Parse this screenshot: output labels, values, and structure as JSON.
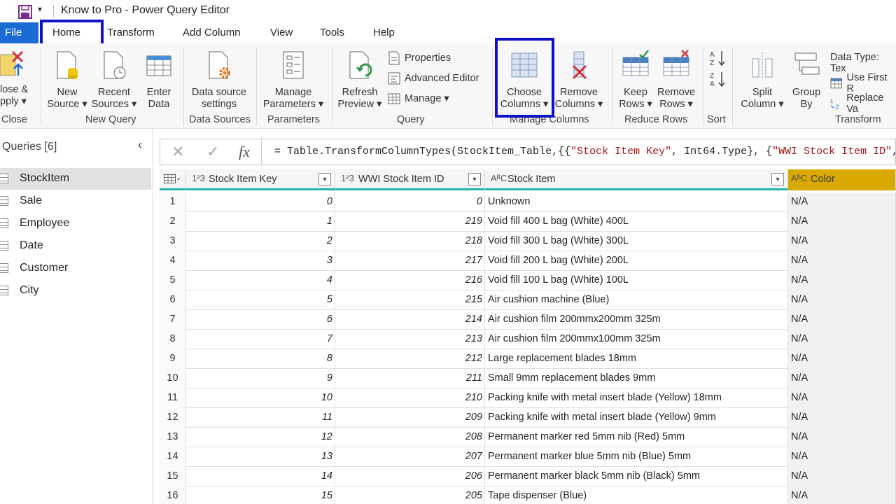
{
  "app": {
    "title": "Know to Pro - Power Query Editor",
    "qat_arrow": "▾"
  },
  "menu": {
    "file": "File",
    "tabs": [
      "Home",
      "Transform",
      "Add Column",
      "View",
      "Tools",
      "Help"
    ]
  },
  "ribbon": {
    "close_apply": [
      "lose &",
      "pply ▾"
    ],
    "close_group": "Close",
    "new_source": [
      "New",
      "Source ▾"
    ],
    "recent_sources": [
      "Recent",
      "Sources ▾"
    ],
    "enter_data": [
      "Enter",
      "Data"
    ],
    "new_query_group": "New Query",
    "data_source_settings": [
      "Data source",
      "settings"
    ],
    "data_sources_group": "Data Sources",
    "manage_parameters": [
      "Manage",
      "Parameters ▾"
    ],
    "parameters_group": "Parameters",
    "refresh_preview": [
      "Refresh",
      "Preview ▾"
    ],
    "properties": "Properties",
    "advanced_editor": "Advanced Editor",
    "manage": "Manage ▾",
    "query_group": "Query",
    "choose_columns": [
      "Choose",
      "Columns ▾"
    ],
    "remove_columns": [
      "Remove",
      "Columns ▾"
    ],
    "manage_columns_group": "Manage Columns",
    "keep_rows": [
      "Keep",
      "Rows ▾"
    ],
    "remove_rows": [
      "Remove",
      "Rows ▾"
    ],
    "reduce_rows_group": "Reduce Rows",
    "sort_group": "Sort",
    "split_column": [
      "Split",
      "Column ▾"
    ],
    "group_by": [
      "Group",
      "By"
    ],
    "data_type": "Data Type: Tex",
    "use_first_row": "Use First R",
    "replace_values": "Replace Va",
    "transform_group": "Transform"
  },
  "queries": {
    "header": "Queries [6]",
    "items": [
      "StockItem",
      "Sale",
      "Employee",
      "Date",
      "Customer",
      "City"
    ],
    "selected": "StockItem"
  },
  "formula": {
    "cancel": "✕",
    "commit": "✓",
    "fx": "fx",
    "prefix": "= Table.TransformColumnTypes(StockItem_Table,{{",
    "str1": "\"Stock Item Key\"",
    "mid": ", Int64.Type}, {",
    "str2": "\"WWI Stock Item ID\"",
    "suffix": ", I"
  },
  "columns": [
    {
      "type_icon": "1²3",
      "name": "Stock Item Key"
    },
    {
      "type_icon": "1²3",
      "name": "WWI Stock Item ID"
    },
    {
      "type_icon": "AᴮC",
      "name": "Stock Item"
    },
    {
      "type_icon": "AᴮC",
      "name": "Color"
    }
  ],
  "rows": [
    [
      "1",
      "0",
      "0",
      "Unknown",
      "N/A"
    ],
    [
      "2",
      "1",
      "219",
      "Void fill 400 L bag (White) 400L",
      "N/A"
    ],
    [
      "3",
      "2",
      "218",
      "Void fill 300 L bag (White) 300L",
      "N/A"
    ],
    [
      "4",
      "3",
      "217",
      "Void fill 200 L bag (White) 200L",
      "N/A"
    ],
    [
      "5",
      "4",
      "216",
      "Void fill 100 L bag (White) 100L",
      "N/A"
    ],
    [
      "6",
      "5",
      "215",
      "Air cushion machine (Blue)",
      "N/A"
    ],
    [
      "7",
      "6",
      "214",
      "Air cushion film 200mmx200mm 325m",
      "N/A"
    ],
    [
      "8",
      "7",
      "213",
      "Air cushion film 200mmx100mm 325m",
      "N/A"
    ],
    [
      "9",
      "8",
      "212",
      "Large  replacement blades 18mm",
      "N/A"
    ],
    [
      "10",
      "9",
      "211",
      "Small 9mm replacement blades 9mm",
      "N/A"
    ],
    [
      "11",
      "10",
      "210",
      "Packing knife with metal insert blade (Yellow) 18mm",
      "N/A"
    ],
    [
      "12",
      "11",
      "209",
      "Packing knife with metal insert blade (Yellow) 9mm",
      "N/A"
    ],
    [
      "13",
      "12",
      "208",
      "Permanent marker red 5mm nib (Red) 5mm",
      "N/A"
    ],
    [
      "14",
      "13",
      "207",
      "Permanent marker blue 5mm nib (Blue) 5mm",
      "N/A"
    ],
    [
      "15",
      "14",
      "206",
      "Permanent marker black 5mm nib (Black) 5mm",
      "N/A"
    ],
    [
      "16",
      "15",
      "205",
      "Tape dispenser (Blue)",
      "N/A"
    ]
  ],
  "colors": {
    "file_tab": "#1a6bd4",
    "highlight_box": "#1010c8",
    "header_underline": "#1fb8a8",
    "color_column_header": "#d9a900"
  }
}
